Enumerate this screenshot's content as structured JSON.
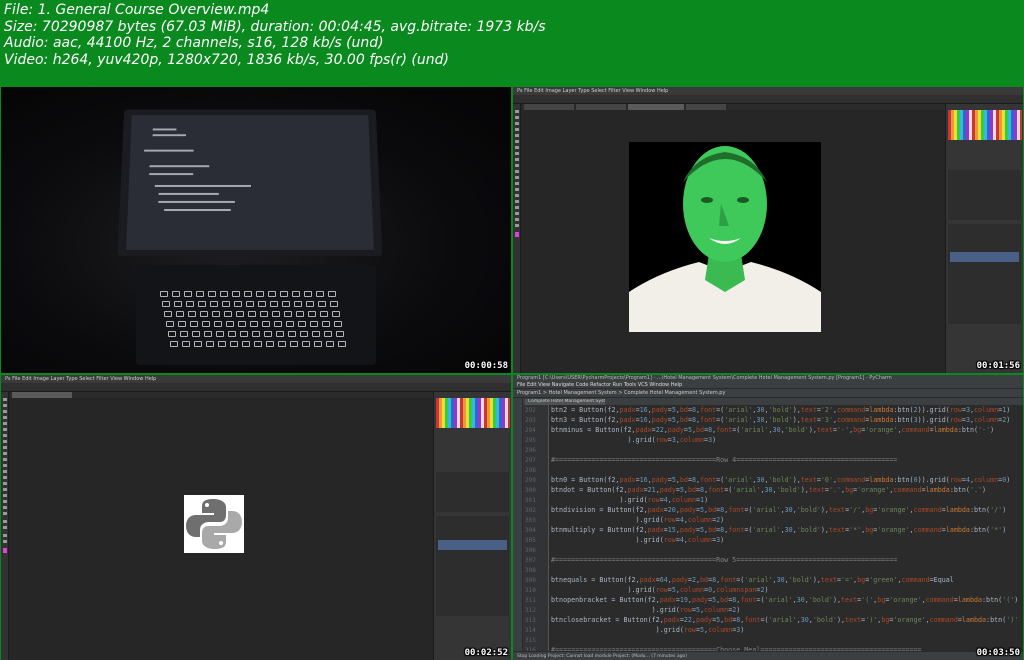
{
  "info": {
    "file": "File: 1. General Course Overview.mp4",
    "size": "Size: 70290987 bytes (67.03 MiB), duration: 00:04:45, avg.bitrate: 1973 kb/s",
    "audio": "Audio: aac, 44100 Hz, 2 channels, s16, 128 kb/s (und)",
    "video": "Video: h264, yuv420p, 1280x720, 1836 kb/s, 30.00 fps(r) (und)"
  },
  "thumbs": [
    {
      "timestamp": "00:00:58"
    },
    {
      "timestamp": "00:01:56"
    },
    {
      "timestamp": "00:02:52"
    },
    {
      "timestamp": "00:03:50"
    }
  ],
  "colors": {
    "background": "#0a8a1e",
    "face_tint": "#3ec95a",
    "python_logo": "#7d7d7d"
  },
  "pycharm": {
    "title": "Program1 [C:\\Users\\USER\\PycharmProjects\\Program1] - ...\\Hotel Management System\\Complete Hotel Management System.py [Program1] - PyCharm",
    "menu": "File  Edit  View  Navigate  Code  Refactor  Run  Tools  VCS  Window  Help",
    "nav": "Program1  >  Hotel Management System  >  Complete Hotel Management System.py",
    "tab": "Complete Hotel Management System.py",
    "status": "Stop Loading Project: Cannot load module Project: (Modu... (7 minutes ago)",
    "line_numbers": [
      "292",
      "293",
      "294",
      "295",
      "296",
      "297",
      "298",
      "299",
      "300",
      "301",
      "302",
      "303",
      "304",
      "305",
      "306",
      "307",
      "308",
      "309",
      "310",
      "311",
      "312",
      "313",
      "314",
      "315",
      "316",
      "317",
      "318"
    ]
  },
  "photoshop": {
    "menu": "Ps  File  Edit  Image  Layer  Type  Select  Filter  View  Window  Help"
  }
}
